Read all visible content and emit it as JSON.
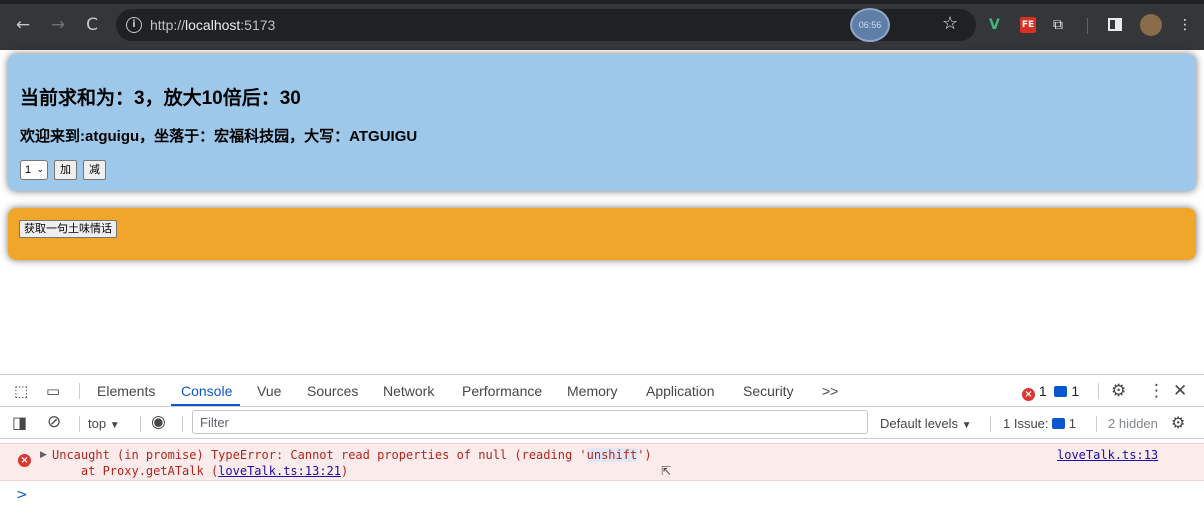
{
  "browser": {
    "back_icon": "←",
    "forward_icon": "→",
    "reload_icon": "C",
    "url_scheme": "http://",
    "url_host": "localhost",
    "url_port": ":5173",
    "timer": "06:56",
    "extensions": [
      "V",
      "FE"
    ]
  },
  "page": {
    "sum_title": "当前求和为：3，放大10倍后：30",
    "school_info": "欢迎来到:atguigu，坐落于：宏福科技园，大写：ATGUIGU",
    "step_select_value": "1",
    "add_button": "加",
    "minus_button": "减",
    "talk_button": "获取一句土味情话"
  },
  "devtools": {
    "tabs": [
      "Elements",
      "Console",
      "Vue",
      "Sources",
      "Network",
      "Performance",
      "Memory",
      "Application",
      "Security"
    ],
    "more_tabs": ">>",
    "active_tab": "Console",
    "error_count": "1",
    "message_count": "1",
    "context": "top",
    "filter_placeholder": "Filter",
    "levels": "Default levels",
    "issues_label": "1 Issue:",
    "issues_count": "1",
    "hidden": "2 hidden",
    "error_line1_pre": "Uncaught (in promise) TypeError: Cannot read properties of null (reading '",
    "error_line1_hl": "unshift",
    "error_line1_post": "')",
    "error_line2_pre": "    at Proxy.getATalk (",
    "error_line2_link": "loveTalk.ts:13:21",
    "error_line2_post": ")",
    "error_source": "loveTalk.ts:13",
    "prompt": ">"
  },
  "colors": {
    "sum_card": "#9ec8ea",
    "talk_card": "#f0a52b",
    "active_tab": "#0b57d0",
    "error_bg": "#fcebeb"
  }
}
